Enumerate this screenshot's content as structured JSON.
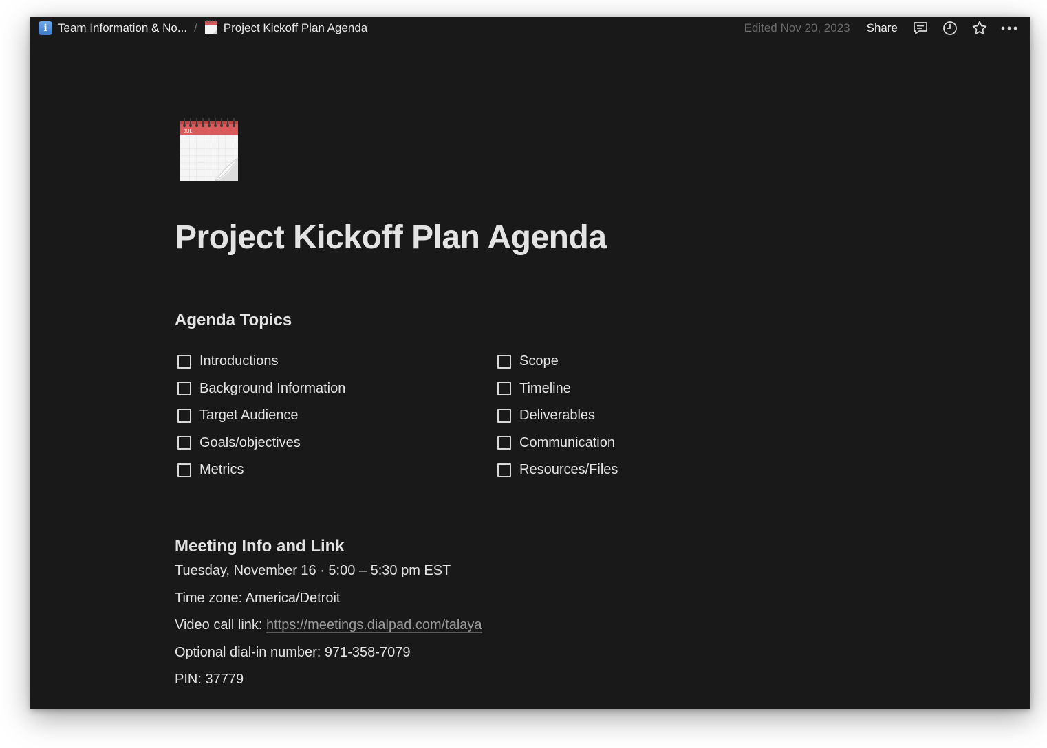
{
  "breadcrumb": {
    "parent_label": "Team Information & No...",
    "parent_icon": "info-icon",
    "separator": "/",
    "current_label": "Project Kickoff Plan Agenda",
    "current_icon": "calendar-icon"
  },
  "topbar": {
    "edited": "Edited Nov 20, 2023",
    "share_label": "Share",
    "icons": [
      "comment-icon",
      "clock-icon",
      "star-icon",
      "more-icon"
    ]
  },
  "page": {
    "icon": "calendar-icon",
    "icon_month": "JUL",
    "title": "Project Kickoff Plan Agenda"
  },
  "agenda": {
    "heading": "Agenda Topics",
    "left_items": [
      {
        "label": "Introductions",
        "checked": false
      },
      {
        "label": "Background Information",
        "checked": false
      },
      {
        "label": "Target Audience",
        "checked": false
      },
      {
        "label": "Goals/objectives",
        "checked": false
      },
      {
        "label": "Metrics",
        "checked": false
      }
    ],
    "right_items": [
      {
        "label": "Scope",
        "checked": false
      },
      {
        "label": "Timeline",
        "checked": false
      },
      {
        "label": "Deliverables",
        "checked": false
      },
      {
        "label": "Communication",
        "checked": false
      },
      {
        "label": "Resources/Files",
        "checked": false
      }
    ]
  },
  "meeting": {
    "heading": "Meeting Info and Link",
    "datetime": "Tuesday, November 16 · 5:00 – 5:30 pm EST",
    "timezone": "Time zone: America/Detroit",
    "video_prefix": "Video call link: ",
    "video_link": "https://meetings.dialpad.com/talaya",
    "dial_in": "Optional dial-in number: 971-358-7079",
    "pin": "PIN: 37779"
  },
  "colors": {
    "background": "#191919",
    "text": "#e3e3e3",
    "muted": "#6b6b6b",
    "link": "#9b9b9b"
  }
}
